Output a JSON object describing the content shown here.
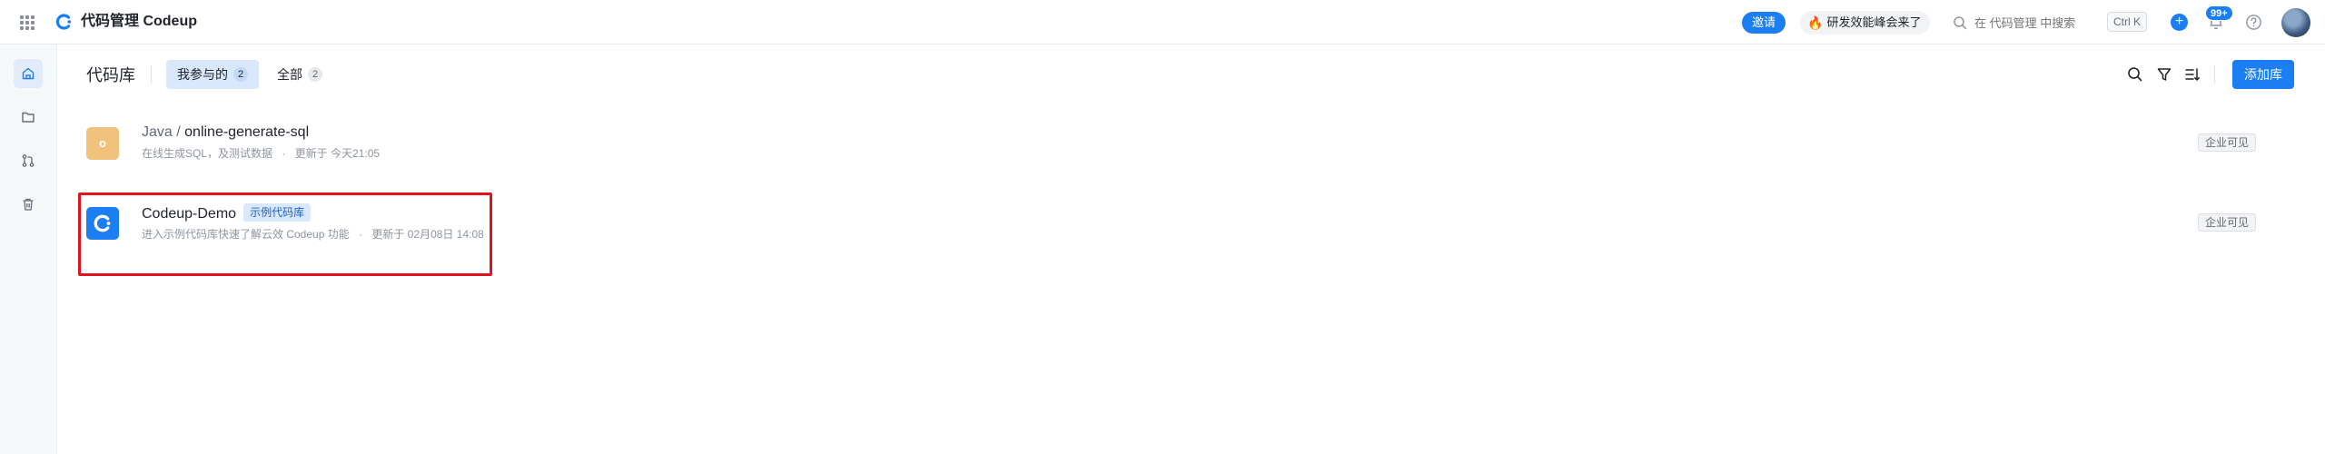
{
  "header": {
    "app_title": "代码管理 Codeup",
    "invite_label": "邀请",
    "promo_label": "研发效能峰会来了",
    "search_placeholder": "在 代码管理 中搜索",
    "shortcut": "Ctrl K",
    "notification_count": "99+",
    "icons": [
      "apps-grid-icon",
      "codeup-logo",
      "search-icon",
      "plus-icon",
      "bell-icon",
      "help-icon",
      "avatar"
    ],
    "accent_color": "#1b7ef2"
  },
  "sidebar": {
    "items": [
      {
        "name": "home",
        "icon": "home-icon",
        "active": true
      },
      {
        "name": "folder",
        "icon": "folder-icon",
        "active": false
      },
      {
        "name": "merge-requests",
        "icon": "merge-request-icon",
        "active": false
      },
      {
        "name": "trash",
        "icon": "trash-icon",
        "active": false
      }
    ]
  },
  "page": {
    "title": "代码库",
    "tabs": [
      {
        "label": "我参与的",
        "count": "2",
        "active": true
      },
      {
        "label": "全部",
        "count": "2",
        "active": false
      }
    ],
    "add_button": "添加库",
    "tool_icons": [
      "search-icon",
      "filter-icon",
      "sort-icon"
    ]
  },
  "repos": [
    {
      "group": "Java / ",
      "name": "online-generate-sql",
      "tag": "",
      "description": "在线生成SQL，及测试数据",
      "dot": "·",
      "updated": "更新于 今天21:05",
      "visibility": "企业可见",
      "icon_letter": "o",
      "icon_color": "#f0c27b"
    },
    {
      "group": "",
      "name": "Codeup-Demo",
      "tag": "示例代码库",
      "description": "进入示例代码库快速了解云效 Codeup 功能",
      "dot": "·",
      "updated": "更新于 02月08日 14:08",
      "visibility": "企业可见",
      "icon_letter": "",
      "icon_color": "#1b7ef2",
      "highlighted": true
    }
  ]
}
